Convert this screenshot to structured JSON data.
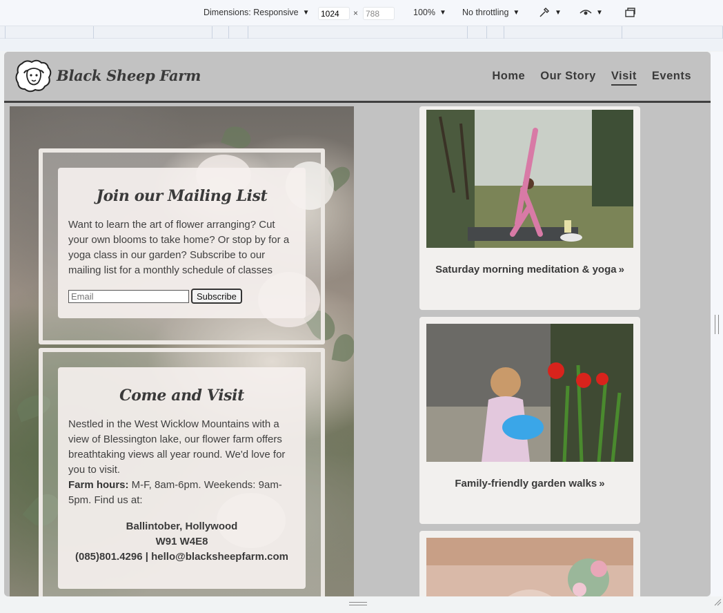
{
  "devtools": {
    "dimensions_label": "Dimensions: Responsive",
    "width_value": "1024",
    "height_value": "788",
    "times": "×",
    "zoom": "100%",
    "throttling": "No throttling"
  },
  "site": {
    "logo_text": "Black Sheep Farm",
    "nav": [
      "Home",
      "Our Story",
      "Visit",
      "Events"
    ],
    "active_nav": "Visit"
  },
  "mailing": {
    "title": "Join our Mailing List",
    "text": "Want to learn the art of flower arranging? Cut your own blooms to take home? Or stop by for a yoga class in our garden? Subscribe to our mailing list for a monthly schedule of classes",
    "email_placeholder": "Email",
    "subscribe_label": "Subscribe"
  },
  "visit": {
    "title": "Come and Visit",
    "text": "Nestled in the West Wicklow Mountains with a view of Blessington lake, our flower farm offers breathtaking views all year round. We'd love for you to visit.",
    "hours_label": "Farm hours:",
    "hours_text": " M-F, 8am-6pm. Weekends: 9am-5pm. Find us at:",
    "address_line1": "Ballintober, Hollywood",
    "address_line2": "W91 W4E8",
    "contact_line": "(085)801.4296 | hello@blacksheepfarm.com"
  },
  "events": [
    {
      "label": "Saturday morning meditation & yoga",
      "icon": "double-chevron-right-icon"
    },
    {
      "label": "Family-friendly garden walks",
      "icon": "double-chevron-right-icon"
    }
  ],
  "colors": {
    "page_bg": "#c2c2c2",
    "text_dark": "#3a3a3a",
    "card_bg": "#f2f0ee"
  }
}
